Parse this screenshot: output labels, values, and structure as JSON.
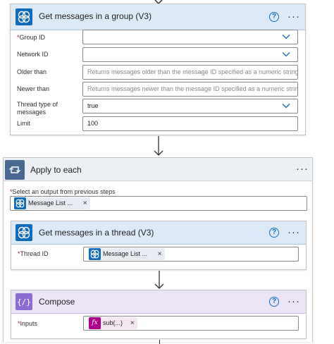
{
  "group_card": {
    "title": "Get messages in a group (V3)",
    "help": "?",
    "more": "···",
    "fields": {
      "group_id": {
        "label": "Group ID",
        "required": "*",
        "value": ""
      },
      "network_id": {
        "label": "Network ID",
        "value": ""
      },
      "older_than": {
        "label": "Older than",
        "placeholder": "Returns messages older than the message ID specified as a numeric string. This"
      },
      "newer_than": {
        "label": "Newer than",
        "placeholder": "Returns messages newer than the message ID specified as a numeric string. The"
      },
      "thread_type": {
        "label_line1": "Thread type of",
        "label_line2": "messages",
        "value": "true"
      },
      "limit": {
        "label": "Limit",
        "value": "100"
      }
    }
  },
  "apply_each": {
    "title": "Apply to each",
    "more": "···",
    "select_label": "Select an output from previous steps",
    "required": "*",
    "token": {
      "label": "Message List ...",
      "close": "×"
    }
  },
  "thread_card": {
    "title": "Get messages in a thread (V3)",
    "help": "?",
    "more": "···",
    "thread_id": {
      "label": "Thread ID",
      "required": "*",
      "token_label": "Message List ...",
      "close": "×"
    }
  },
  "compose_card": {
    "title": "Compose",
    "help": "?",
    "more": "···",
    "inputs": {
      "label": "Inputs",
      "required": "*",
      "token_label": "sub(...)",
      "fx": "fx",
      "close": "×"
    }
  },
  "colors": {
    "yammer_icon": "#0f6cbd",
    "apply_icon": "#486991",
    "compose_icon": "#8c6cd0",
    "fx_token": "#ad008c"
  }
}
